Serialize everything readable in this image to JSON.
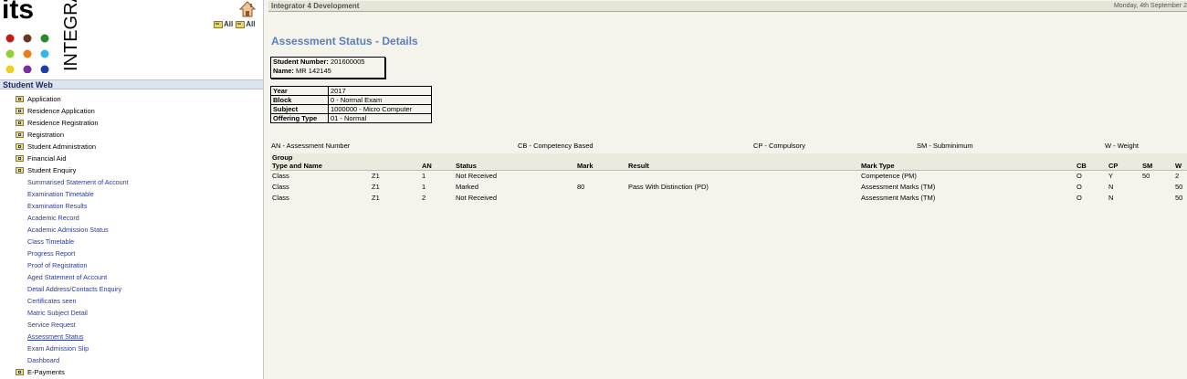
{
  "logo": {
    "text_vertical": "INTEGRATOR",
    "text_big": "its"
  },
  "sidebar": {
    "expand_all_label": "All",
    "collapse_all_label": "All",
    "header": "Student Web",
    "items": [
      {
        "label": "Application"
      },
      {
        "label": "Residence Application"
      },
      {
        "label": "Residence Registration"
      },
      {
        "label": "Registration"
      },
      {
        "label": "Student Administration"
      },
      {
        "label": "Financial Aid"
      },
      {
        "label": "Student Enquiry"
      }
    ],
    "subitems": [
      "Summarised Statement of Account",
      "Examination Timetable",
      "Examination Results",
      "Academic Record",
      "Academic Admission Status",
      "Class Timetable",
      "Progress Report",
      "Proof of Registration",
      "Aged Statement of Account",
      "Detail Address/Contacts Enquiry",
      "Certificates seen",
      "Matric Subject Detail",
      "Service Request",
      "Assessment Status",
      "Exam Admission Slip",
      "Dashboard"
    ],
    "last_item": "E-Payments"
  },
  "topbar": {
    "title": "Integrator 4 Development",
    "date": "Monday, 4th September 2"
  },
  "page": {
    "title": "Assessment Status - Details",
    "student_number_label": "Student Number:",
    "student_number": "201600005",
    "name_label": "Name:",
    "name": "MR  142145"
  },
  "info": {
    "year_label": "Year",
    "year": "2017",
    "block_label": "Block",
    "block": "0 - Normal Exam",
    "subject_label": "Subject",
    "subject": "1000000 - Micro Computer",
    "offering_label": "Offering Type",
    "offering": "01 - Normal"
  },
  "legend": {
    "an": "AN - Assessment Number",
    "cb": "CB - Competency Based",
    "cp": "CP - Compulsory",
    "sm": "SM - Subminimum",
    "w": "W - Weight"
  },
  "table": {
    "headers": {
      "group_line1": "Group",
      "group_line2": "Type and Name",
      "an": "AN",
      "status": "Status",
      "mark": "Mark",
      "result": "Result",
      "mark_type": "Mark Type",
      "cb": "CB",
      "cp": "CP",
      "sm": "SM",
      "w": "W"
    },
    "rows": [
      {
        "type": "Class",
        "name": "Z1",
        "an": "1",
        "status": "Not Received",
        "mark": "",
        "result": "",
        "mark_type": "Competence (PM)",
        "cb": "O",
        "cp": "Y",
        "sm": "50",
        "w": "2"
      },
      {
        "type": "Class",
        "name": "Z1",
        "an": "1",
        "status": "Marked",
        "mark": "80",
        "result": "Pass With Distinction (PD)",
        "mark_type": "Assessment Marks (TM)",
        "cb": "O",
        "cp": "N",
        "sm": "",
        "w": "50"
      },
      {
        "type": "Class",
        "name": "Z1",
        "an": "2",
        "status": "Not Received",
        "mark": "",
        "result": "",
        "mark_type": "Assessment Marks (TM)",
        "cb": "O",
        "cp": "N",
        "sm": "",
        "w": "50"
      }
    ]
  }
}
